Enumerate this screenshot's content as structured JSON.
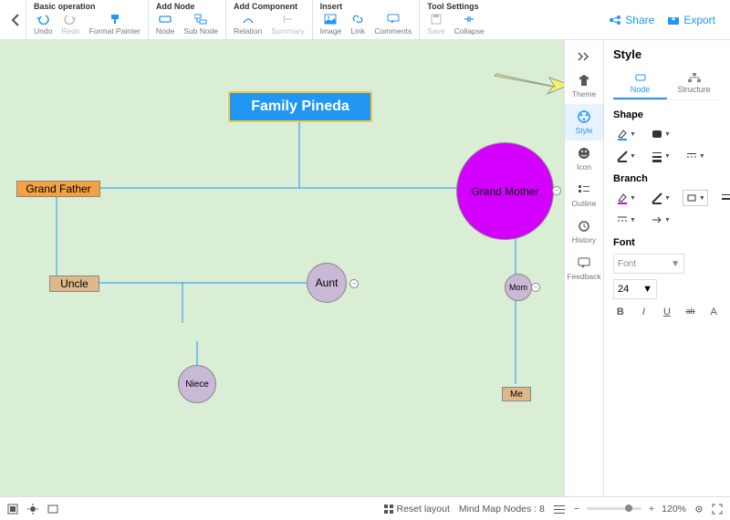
{
  "toolbar": {
    "groups": [
      {
        "title": "Basic operation",
        "items": [
          {
            "label": "Undo",
            "icon": "undo-icon",
            "enabled": true
          },
          {
            "label": "Redo",
            "icon": "redo-icon",
            "enabled": false
          },
          {
            "label": "Format Painter",
            "icon": "format-painter-icon",
            "enabled": true
          }
        ]
      },
      {
        "title": "Add Node",
        "items": [
          {
            "label": "Node",
            "icon": "node-icon",
            "enabled": true
          },
          {
            "label": "Sub Node",
            "icon": "subnode-icon",
            "enabled": true
          }
        ]
      },
      {
        "title": "Add Component",
        "items": [
          {
            "label": "Relation",
            "icon": "relation-icon",
            "enabled": true
          },
          {
            "label": "Summary",
            "icon": "summary-icon",
            "enabled": false
          }
        ]
      },
      {
        "title": "Insert",
        "items": [
          {
            "label": "Image",
            "icon": "image-icon",
            "enabled": true
          },
          {
            "label": "Link",
            "icon": "link-icon",
            "enabled": true
          },
          {
            "label": "Comments",
            "icon": "comments-icon",
            "enabled": true
          }
        ]
      },
      {
        "title": "Tool Settings",
        "items": [
          {
            "label": "Save",
            "icon": "save-icon",
            "enabled": false
          },
          {
            "label": "Collapse",
            "icon": "collapse-icon",
            "enabled": true
          }
        ]
      }
    ],
    "share": "Share",
    "export": "Export"
  },
  "nodes": {
    "root": "Family Pineda",
    "grandfather": "Grand Father",
    "grandmother": "Grand Mother",
    "uncle": "Uncle",
    "aunt": "Aunt",
    "mom": "Mom",
    "niece": "Niece",
    "me": "Me"
  },
  "side_rail": {
    "items": [
      {
        "label": "Theme",
        "icon": "theme-icon"
      },
      {
        "label": "Style",
        "icon": "style-icon"
      },
      {
        "label": "Icon",
        "icon": "smiley-icon"
      },
      {
        "label": "Outline",
        "icon": "outline-icon"
      },
      {
        "label": "History",
        "icon": "history-icon"
      },
      {
        "label": "Feedback",
        "icon": "feedback-icon"
      }
    ],
    "active": 1
  },
  "panel": {
    "title": "Style",
    "tabs": [
      {
        "label": "Node"
      },
      {
        "label": "Structure"
      }
    ],
    "active_tab": 0,
    "sections": {
      "shape": "Shape",
      "branch": "Branch",
      "font": "Font"
    },
    "font_placeholder": "Font",
    "font_size": "24",
    "font_buttons": [
      "B",
      "I",
      "U",
      "ab",
      "A"
    ]
  },
  "bottom": {
    "reset": "Reset layout",
    "nodes_label": "Mind Map Nodes :",
    "nodes_count": "8",
    "zoom": "120%"
  },
  "colors": {
    "accent": "#2196F3",
    "magenta": "#d400ff",
    "orange": "#f5a142",
    "tan": "#deb887",
    "lav": "#c9b8d6"
  }
}
